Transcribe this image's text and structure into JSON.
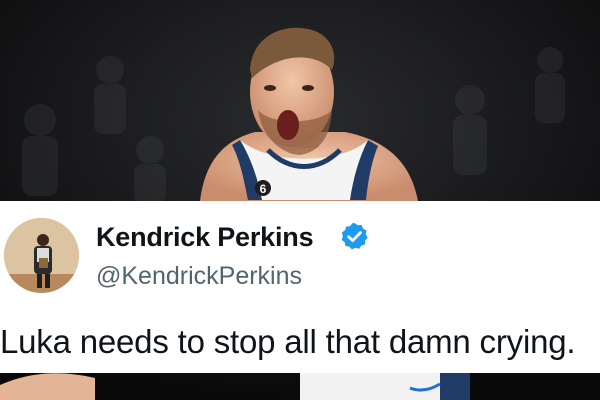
{
  "background_photo": {
    "subject": "Luka Dončić shouting in white Dallas Mavericks jersey",
    "jersey_number": "6"
  },
  "tweet": {
    "author_name": "Kendrick Perkins",
    "handle": "@KendrickPerkins",
    "verified": true,
    "text": "Luka needs to stop all that damn crying."
  },
  "colors": {
    "card_background": "#ffffff",
    "name_color": "#0f1419",
    "handle_color": "#536471",
    "verified_color": "#1d9bf0",
    "jersey_trim": "#1f3b66"
  },
  "icons": {
    "verified": "verified-check-icon"
  }
}
